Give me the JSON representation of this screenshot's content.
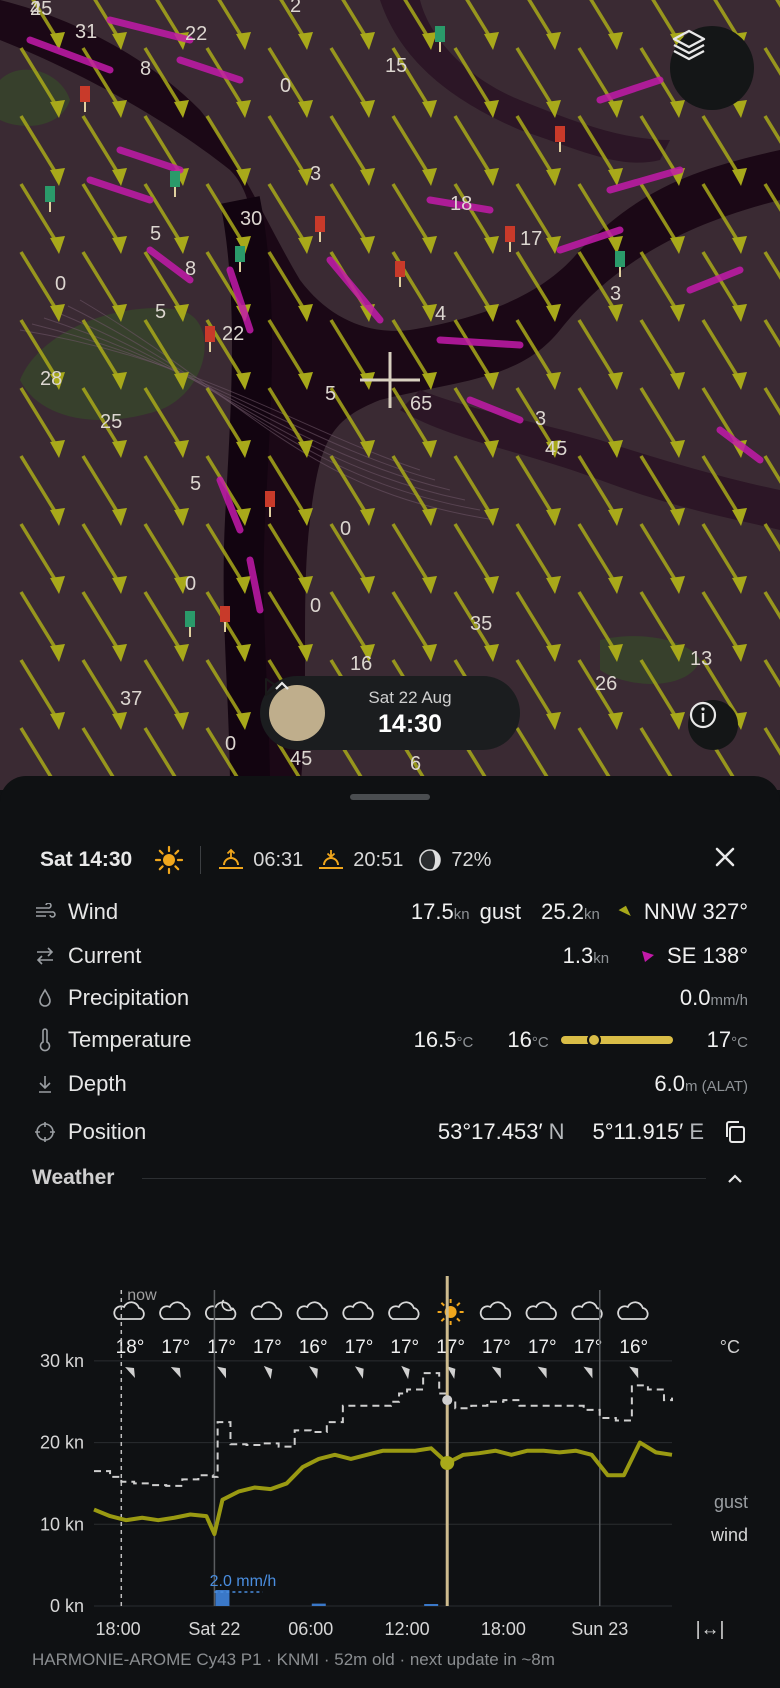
{
  "map": {
    "depth_labels": [
      "4",
      "31",
      "22",
      "2",
      "8",
      "0",
      "15",
      "3",
      "30",
      "18",
      "17",
      "5",
      "8",
      "4",
      "5",
      "0",
      "28",
      "25",
      "22",
      "65",
      "5",
      "3",
      "45",
      "5",
      "0",
      "0",
      "35",
      "13",
      "26",
      "37",
      "0",
      "16",
      "0",
      "45",
      "6",
      "3",
      "25"
    ],
    "colors": {
      "land": "#37402c",
      "water_deep": "#1b0816",
      "water_mid": "#2c1626",
      "sea": "#3a2a33",
      "wind_arrow": "#a8a91a",
      "current_arrow": "#c21aa9"
    }
  },
  "timebar": {
    "date": "Sat 22 Aug",
    "time": "14:30"
  },
  "header": {
    "title": "Sat 14:30",
    "sunrise": "06:31",
    "sunset": "20:51",
    "moon": "72%"
  },
  "rows": {
    "wind": {
      "label": "Wind",
      "value": "17.5",
      "unit": "kn",
      "gust_label": "gust",
      "gust_value": "25.2",
      "gust_unit": "kn",
      "direction": "NNW 327°"
    },
    "current": {
      "label": "Current",
      "value": "1.3",
      "unit": "kn",
      "direction": "SE 138°"
    },
    "precipitation": {
      "label": "Precipitation",
      "value": "0.0",
      "unit": "mm/h"
    },
    "temperature": {
      "label": "Temperature",
      "value": "16.5",
      "unit": "°C",
      "min": "16",
      "min_unit": "°C",
      "max": "17",
      "max_unit": "°C",
      "range_position": 0.3
    },
    "depth": {
      "label": "Depth",
      "value": "6.0",
      "unit": "m (ALAT)"
    },
    "position": {
      "label": "Position",
      "lat": "53°17.453′",
      "lat_hemi": "N",
      "lon": "5°11.915′",
      "lon_hemi": "E"
    }
  },
  "weather": {
    "title": "Weather",
    "temp_unit": "°C",
    "icons": [
      "cloud-icon",
      "cloud-icon",
      "partly-cloudy-night-icon",
      "cloud-icon",
      "cloud-icon",
      "cloud-icon",
      "cloud-icon",
      "sun-icon",
      "cloud-icon",
      "cloud-icon",
      "cloud-icon",
      "cloud-icon"
    ],
    "temps": [
      "18°",
      "17°",
      "17°",
      "17°",
      "16°",
      "17°",
      "17°",
      "17°",
      "17°",
      "17°",
      "17°",
      "16°"
    ],
    "wind_dirs_deg": [
      315,
      315,
      320,
      330,
      325,
      325,
      330,
      327,
      320,
      320,
      320,
      320
    ]
  },
  "chart_data": {
    "type": "line",
    "ylabel": "",
    "y_ticks": [
      "30 kn",
      "20 kn",
      "10 kn",
      "0 kn"
    ],
    "ylim": [
      0,
      35
    ],
    "x_ticks": [
      "18:00",
      "Sat 22",
      "06:00",
      "12:00",
      "18:00",
      "Sun 23"
    ],
    "x_hours": [
      18,
      24,
      30,
      36,
      42,
      48
    ],
    "xlim": [
      16.5,
      52.5
    ],
    "now_label": "now",
    "now_hour": 18.2,
    "cursor_hour": 38.5,
    "day_lines": [
      24,
      48
    ],
    "series": [
      {
        "name": "gust",
        "x": [
          16.5,
          17.5,
          18.2,
          19,
          20,
          21,
          22,
          23,
          23.9,
          24.2,
          25,
          26,
          27,
          28,
          29,
          30,
          31,
          32,
          33,
          34,
          35,
          35.5,
          36,
          37,
          38,
          38.5,
          39,
          40,
          41,
          42,
          43,
          44,
          45,
          46,
          47,
          48,
          49,
          50,
          51,
          52,
          52.5
        ],
        "y": [
          16.5,
          15.8,
          15.2,
          15,
          14.8,
          14.7,
          15.5,
          16,
          15.8,
          22.5,
          19.8,
          19.7,
          19.9,
          19.5,
          21.5,
          21.3,
          22.5,
          24.5,
          24.5,
          24.5,
          25,
          26,
          26.5,
          28.5,
          26,
          25.2,
          24.2,
          24.5,
          25,
          25.2,
          24.5,
          24.5,
          24.5,
          24.5,
          24,
          23,
          22.7,
          27,
          26.5,
          25.2,
          25.5
        ]
      },
      {
        "name": "wind",
        "x": [
          16.5,
          17.5,
          18.5,
          19.5,
          20.5,
          21.5,
          22.5,
          23.5,
          24,
          24.5,
          25.5,
          26.5,
          27.5,
          28.5,
          29.5,
          30.5,
          31.5,
          32.5,
          33.5,
          34.5,
          35.5,
          36.5,
          37.5,
          38.5,
          39.5,
          40.5,
          41.5,
          42.5,
          43.5,
          44.5,
          45.5,
          46.5,
          47.5,
          48.5,
          49.5,
          50.5,
          51.5,
          52.5
        ],
        "y": [
          11.8,
          11,
          10.5,
          10.8,
          10.5,
          10.8,
          11.2,
          11,
          8.8,
          13,
          14,
          14.5,
          14.3,
          15,
          17,
          18,
          18.5,
          18,
          18.5,
          19,
          19,
          19,
          19.3,
          17.5,
          18.5,
          18.7,
          19,
          18.5,
          19,
          19,
          18.8,
          19,
          18.5,
          16,
          16,
          20,
          18.8,
          18.5
        ]
      },
      {
        "name": "precipitation",
        "x": [
          24.5,
          30.5,
          37.5
        ],
        "y": [
          2.0,
          0.3,
          0.2
        ]
      }
    ],
    "annotations": [
      "2.0 mm/h"
    ],
    "legend": [
      "gust",
      "wind"
    ],
    "expand_label": "|↔|"
  },
  "footer": {
    "text": "HARMONIE-AROME Cy43 P1 · KNMI · 52m old · next update in ~8m"
  }
}
